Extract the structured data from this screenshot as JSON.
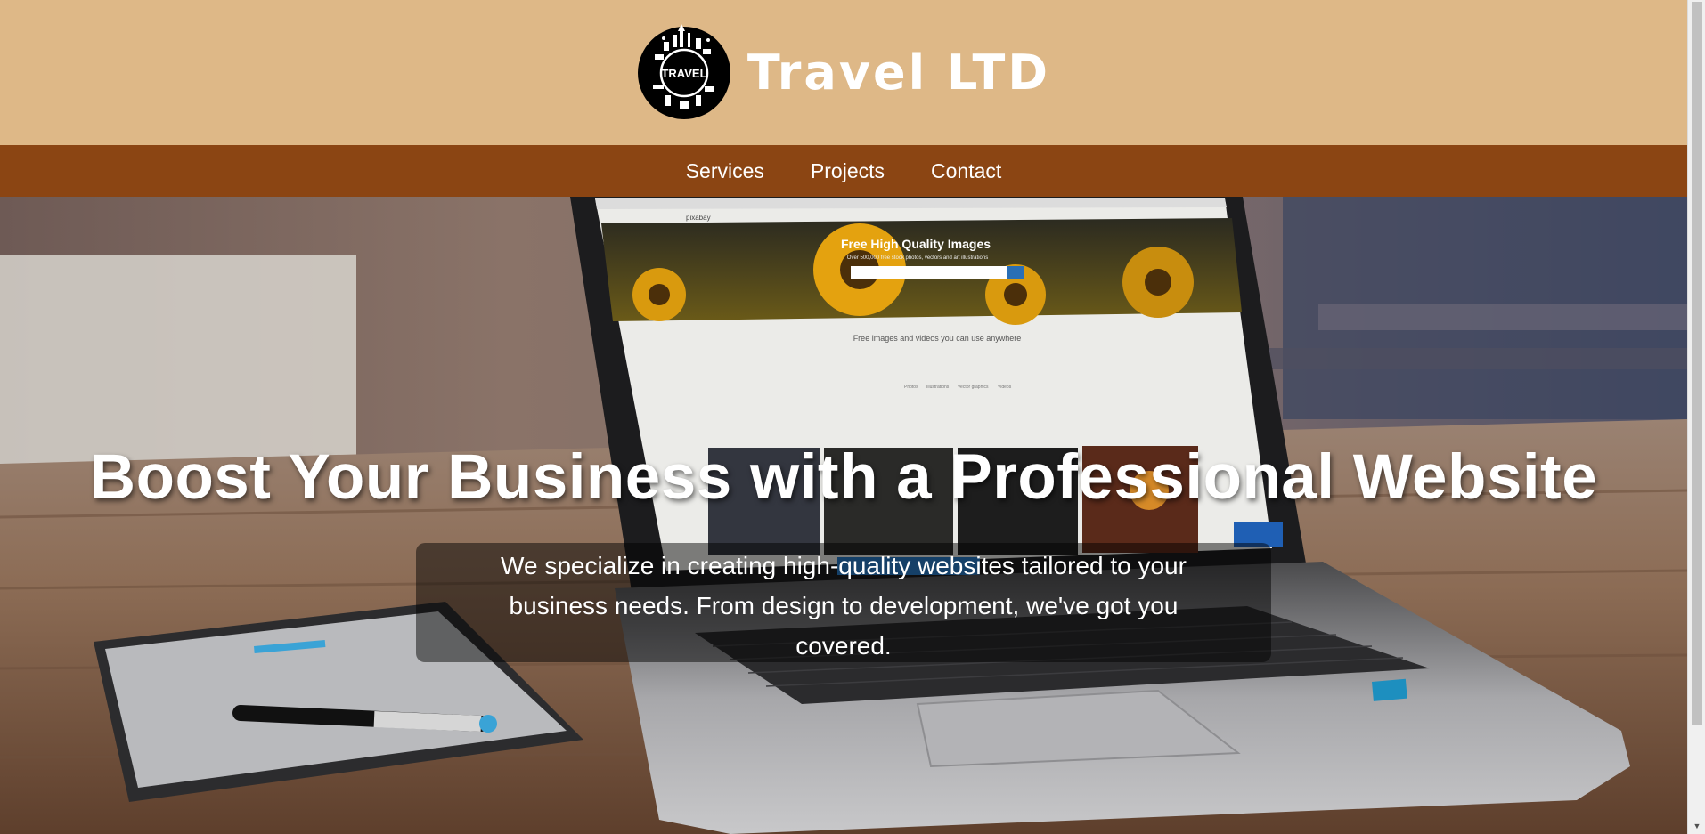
{
  "header": {
    "logo_text": "TRAVEL",
    "brand": "Travel LTD"
  },
  "nav": {
    "items": [
      "Services",
      "Projects",
      "Contact"
    ]
  },
  "hero": {
    "title": "Boost Your Business with a Professional Website",
    "description": "We specialize in creating high-quality websites tailored to your business needs. From design to development, we've got you covered."
  },
  "screen_mockup": {
    "site_name": "pixabay",
    "banner_title": "Free High Quality Images",
    "banner_subtitle": "Over 500,000 free stock photos, vectors and art illustrations",
    "tagline": "Free images and videos you can use anywhere",
    "tabs": [
      "Photos",
      "Illustrations",
      "Vector graphics",
      "Videos"
    ]
  },
  "colors": {
    "header_bg": "#deb887",
    "nav_bg": "#8b4513",
    "brand_text": "#ffffff"
  }
}
